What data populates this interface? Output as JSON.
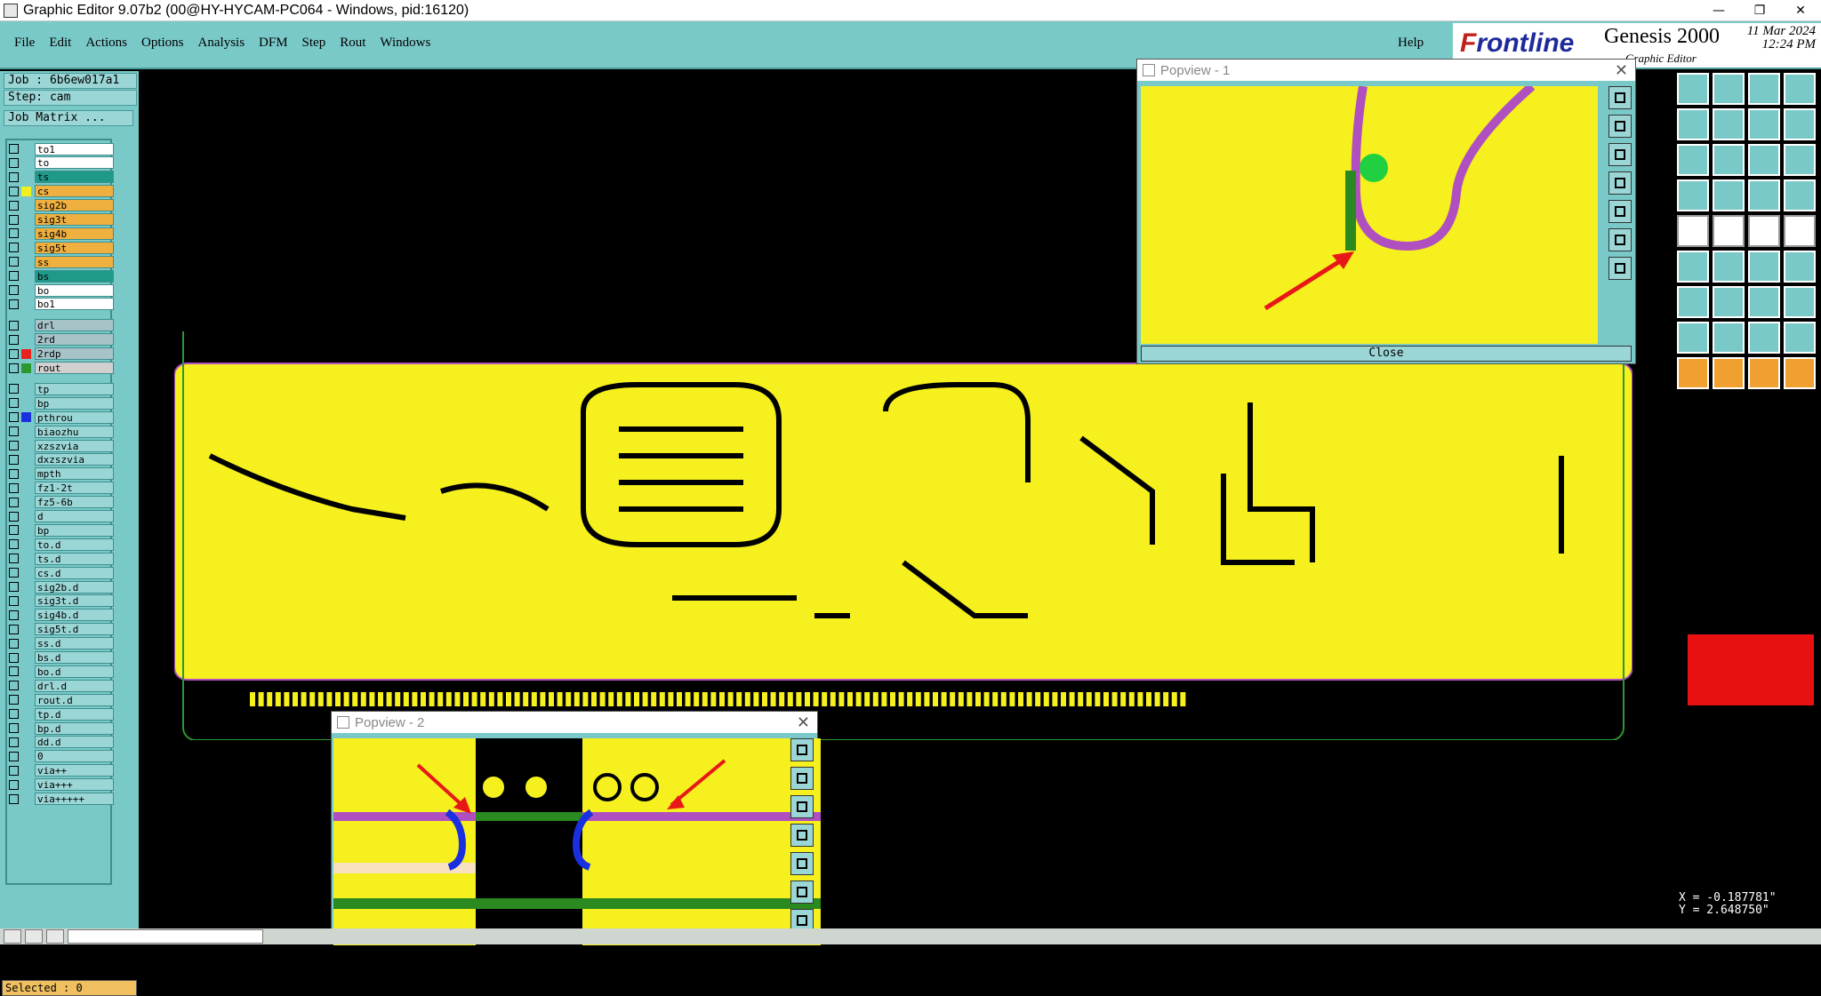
{
  "window": {
    "title": "Graphic Editor 9.07b2 (00@HY-HYCAM-PC064 - Windows, pid:16120)",
    "min": "—",
    "max": "❐",
    "close": "✕"
  },
  "menu": {
    "items": [
      "File",
      "Edit",
      "Actions",
      "Options",
      "Analysis",
      "DFM",
      "Step",
      "Rout",
      "Windows"
    ],
    "help": "Help"
  },
  "brand": {
    "logo_a": "F",
    "logo_b": "rontline",
    "product": "Genesis 2000",
    "subtitle": "Graphic Editor",
    "date": "11 Mar 2024",
    "time": "12:24 PM"
  },
  "job": {
    "job_label": "Job : 6b6ew017a1",
    "step_label": "Step: cam",
    "matrix_button": "Job Matrix ..."
  },
  "layers": [
    {
      "name": "to1",
      "bg": "#ffffff",
      "swatch": ""
    },
    {
      "name": "to",
      "bg": "#ffffff",
      "swatch": ""
    },
    {
      "name": "ts",
      "bg": "#1f9a8a",
      "swatch": ""
    },
    {
      "name": "cs",
      "bg": "#f0b040",
      "swatch": "#f0f020"
    },
    {
      "name": "sig2b",
      "bg": "#f0b040",
      "swatch": ""
    },
    {
      "name": "sig3t",
      "bg": "#f0b040",
      "swatch": ""
    },
    {
      "name": "sig4b",
      "bg": "#f0b040",
      "swatch": ""
    },
    {
      "name": "sig5t",
      "bg": "#f0b040",
      "swatch": ""
    },
    {
      "name": "ss",
      "bg": "#f0b040",
      "swatch": ""
    },
    {
      "name": "bs",
      "bg": "#1f9a8a",
      "swatch": ""
    },
    {
      "name": "bo",
      "bg": "#ffffff",
      "swatch": ""
    },
    {
      "name": "bo1",
      "bg": "#ffffff",
      "swatch": ""
    },
    {
      "name": "drl",
      "bg": "#a7c3c8",
      "swatch": ""
    },
    {
      "name": "2rd",
      "bg": "#a7c3c8",
      "swatch": ""
    },
    {
      "name": "2rdp",
      "bg": "#a7c3c8",
      "swatch": "#e82020"
    },
    {
      "name": "rout",
      "bg": "#d0d0d0",
      "swatch": "#2a9a30"
    },
    {
      "name": "tp",
      "bg": "#9bd6d6",
      "swatch": ""
    },
    {
      "name": "bp",
      "bg": "#9bd6d6",
      "swatch": ""
    },
    {
      "name": "pthrou",
      "bg": "#9bd6d6",
      "swatch": "#1a30e0"
    },
    {
      "name": "biaozhu",
      "bg": "#9bd6d6",
      "swatch": ""
    },
    {
      "name": "xzszvia",
      "bg": "#9bd6d6",
      "swatch": ""
    },
    {
      "name": "dxzszvia",
      "bg": "#9bd6d6",
      "swatch": ""
    },
    {
      "name": "mpth",
      "bg": "#9bd6d6",
      "swatch": ""
    },
    {
      "name": "fz1-2t",
      "bg": "#9bd6d6",
      "swatch": ""
    },
    {
      "name": "fz5-6b",
      "bg": "#9bd6d6",
      "swatch": ""
    },
    {
      "name": "d",
      "bg": "#9bd6d6",
      "swatch": ""
    },
    {
      "name": "bp",
      "bg": "#9bd6d6",
      "swatch": ""
    },
    {
      "name": "to.d",
      "bg": "#9bd6d6",
      "swatch": ""
    },
    {
      "name": "ts.d",
      "bg": "#9bd6d6",
      "swatch": ""
    },
    {
      "name": "cs.d",
      "bg": "#9bd6d6",
      "swatch": ""
    },
    {
      "name": "sig2b.d",
      "bg": "#9bd6d6",
      "swatch": ""
    },
    {
      "name": "sig3t.d",
      "bg": "#9bd6d6",
      "swatch": ""
    },
    {
      "name": "sig4b.d",
      "bg": "#9bd6d6",
      "swatch": ""
    },
    {
      "name": "sig5t.d",
      "bg": "#9bd6d6",
      "swatch": ""
    },
    {
      "name": "ss.d",
      "bg": "#9bd6d6",
      "swatch": ""
    },
    {
      "name": "bs.d",
      "bg": "#9bd6d6",
      "swatch": ""
    },
    {
      "name": "bo.d",
      "bg": "#9bd6d6",
      "swatch": ""
    },
    {
      "name": "drl.d",
      "bg": "#9bd6d6",
      "swatch": ""
    },
    {
      "name": "rout.d",
      "bg": "#9bd6d6",
      "swatch": ""
    },
    {
      "name": "tp.d",
      "bg": "#9bd6d6",
      "swatch": ""
    },
    {
      "name": "bp.d",
      "bg": "#9bd6d6",
      "swatch": ""
    },
    {
      "name": "dd.d",
      "bg": "#9bd6d6",
      "swatch": ""
    },
    {
      "name": "0",
      "bg": "#9bd6d6",
      "swatch": ""
    },
    {
      "name": "via++",
      "bg": "#9bd6d6",
      "swatch": ""
    },
    {
      "name": "via+++",
      "bg": "#9bd6d6",
      "swatch": ""
    },
    {
      "name": "via+++++",
      "bg": "#9bd6d6",
      "swatch": ""
    }
  ],
  "status": {
    "selected": "Selected : 0"
  },
  "popview1": {
    "title": "Popview - 1",
    "close_label": "Close",
    "close_x": "✕"
  },
  "popview2": {
    "title": "Popview - 2",
    "close_x": "✕"
  },
  "coords": {
    "x": "X = -0.187781\"",
    "y": "Y = 2.648750\""
  },
  "colors": {
    "board": "#f5f01e",
    "trace": "#000000",
    "outline": "#b050c0",
    "menu_bg": "#7ac9c9",
    "arrow": "#e81818"
  }
}
